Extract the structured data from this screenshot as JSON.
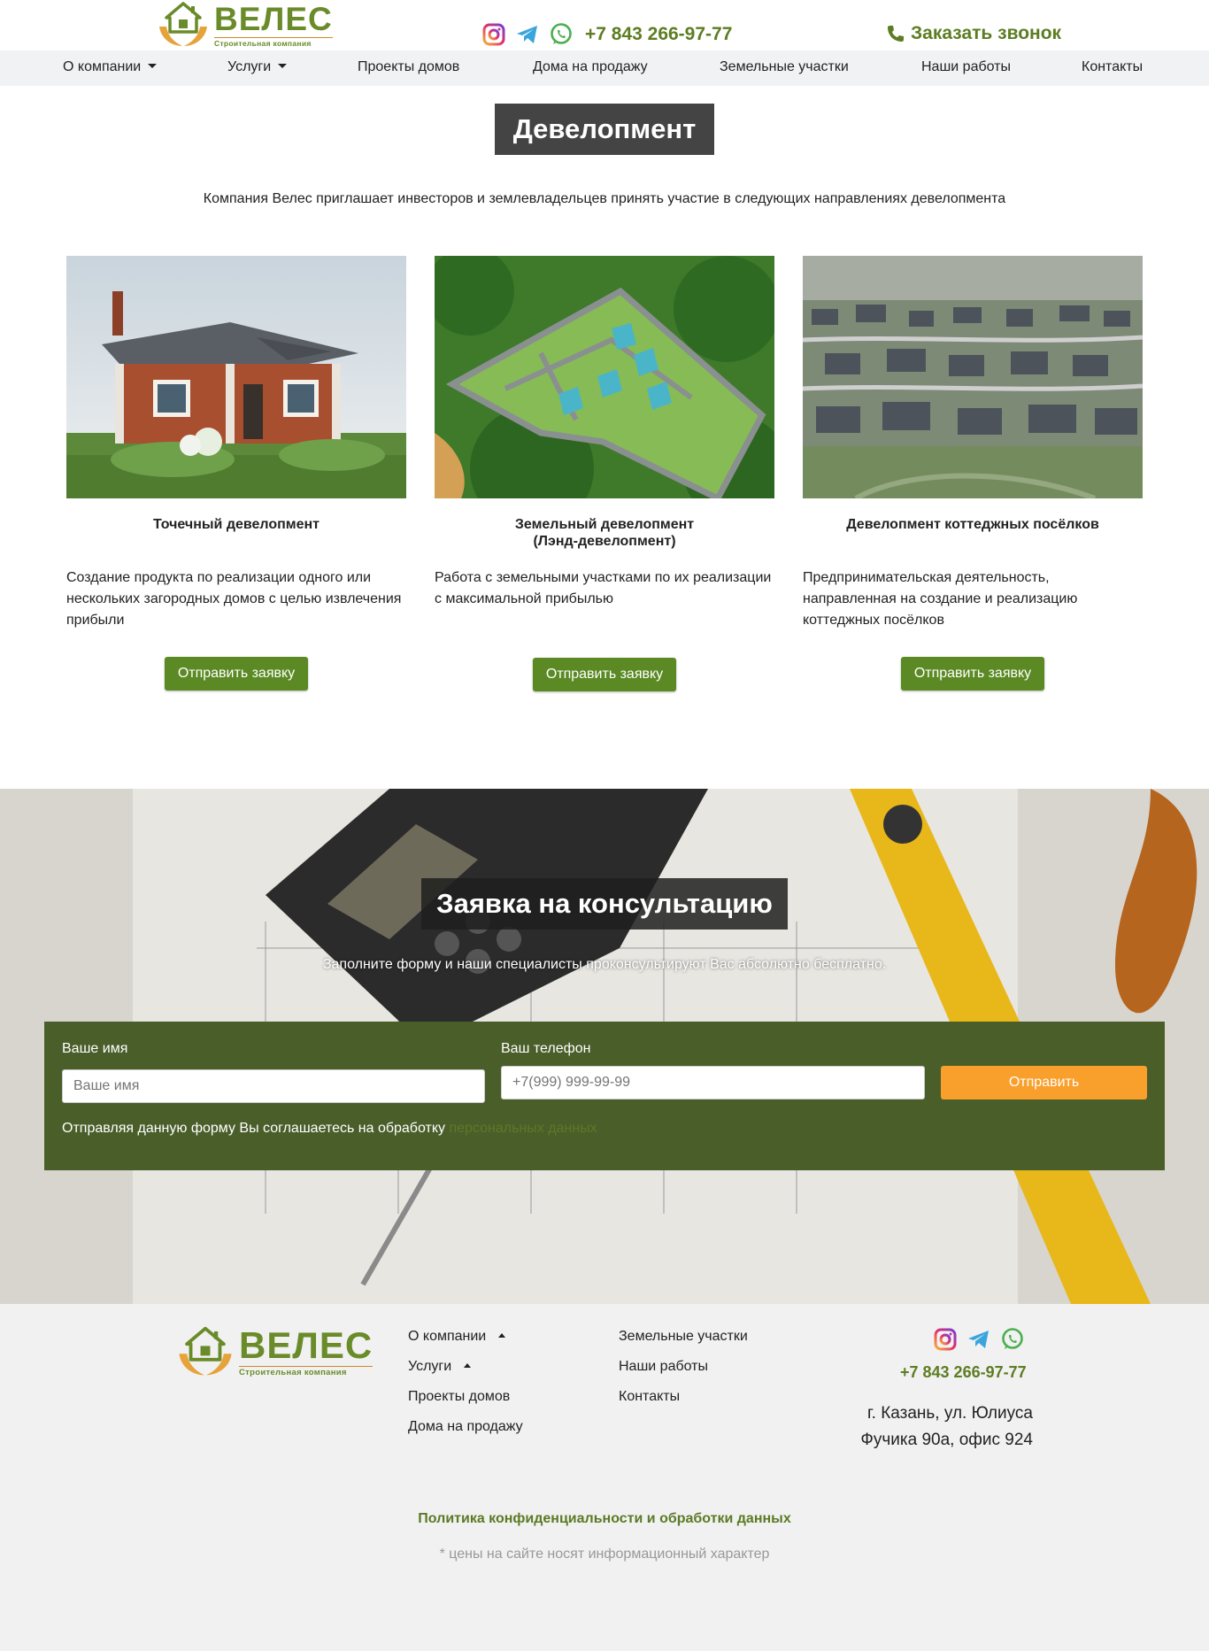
{
  "header": {
    "logo_name": "ВЕЛЕС",
    "logo_subtitle": "Строительная компания",
    "phone": "+7 843 266-97-77",
    "callback_label": "Заказать звонок",
    "socials": [
      "instagram-icon",
      "telegram-icon",
      "whatsapp-icon"
    ]
  },
  "nav": {
    "items": [
      {
        "label": "О компании",
        "dropdown": true
      },
      {
        "label": "Услуги",
        "dropdown": true
      },
      {
        "label": "Проекты домов"
      },
      {
        "label": "Дома на продажу"
      },
      {
        "label": "Земельные участки"
      },
      {
        "label": "Наши работы"
      },
      {
        "label": "Контакты"
      }
    ]
  },
  "main": {
    "title": "Девелопмент",
    "intro": "Компания Велес приглашает инвесторов и землевладельцев принять участие в следующих направлениях девелопмента",
    "cards": [
      {
        "title": "Точечный девелопмент",
        "title2": "",
        "desc": "Создание продукта по реализации одного или нескольких загородных домов с целью извлечения прибыли",
        "button": "Отправить заявку"
      },
      {
        "title": "Земельный девелопмент",
        "title2": "(Лэнд-девелопмент)",
        "desc": "Работа с земельными участками по их реализации с максимальной прибылью",
        "button": "Отправить заявку"
      },
      {
        "title": "Девелопмент коттеджных посёлков",
        "title2": "",
        "desc": "Предпринимательская деятельность, направленная на создание и реализацию коттеджных посёлков",
        "button": "Отправить заявку"
      }
    ]
  },
  "consult": {
    "title": "Заявка на консультацию",
    "subtitle": "Заполните форму и наши специалисты проконсультируют Вас абсолютно бесплатно.",
    "name_label": "Ваше имя",
    "name_placeholder": "Ваше имя",
    "phone_label": "Ваш телефон",
    "phone_placeholder": "+7(999) 999-99-99",
    "submit": "Отправить",
    "agree_text": "Отправляя данную форму Вы соглашаетесь на обработку",
    "agree_link": "персональных данных"
  },
  "footer": {
    "logo_name": "ВЕЛЕС",
    "logo_subtitle": "Строительная компания",
    "col1": [
      "О компании",
      "Услуги",
      "Проекты домов",
      "Дома на продажу"
    ],
    "col2": [
      "Земельные участки",
      "Наши работы",
      "Контакты"
    ],
    "phone": "+7 843 266-97-77",
    "address_line1": "г. Казань, ул. Юлиуса",
    "address_line2": "Фучика 90а, офис 924",
    "policy": "Политика конфиденциальности и обработки данных",
    "note": "* цены на сайте носят информационный характер"
  },
  "colors": {
    "brand_green": "#5b8a24",
    "dark_green_panel": "#4a5e2a",
    "orange": "#f99f2c",
    "title_box": "#444444"
  }
}
